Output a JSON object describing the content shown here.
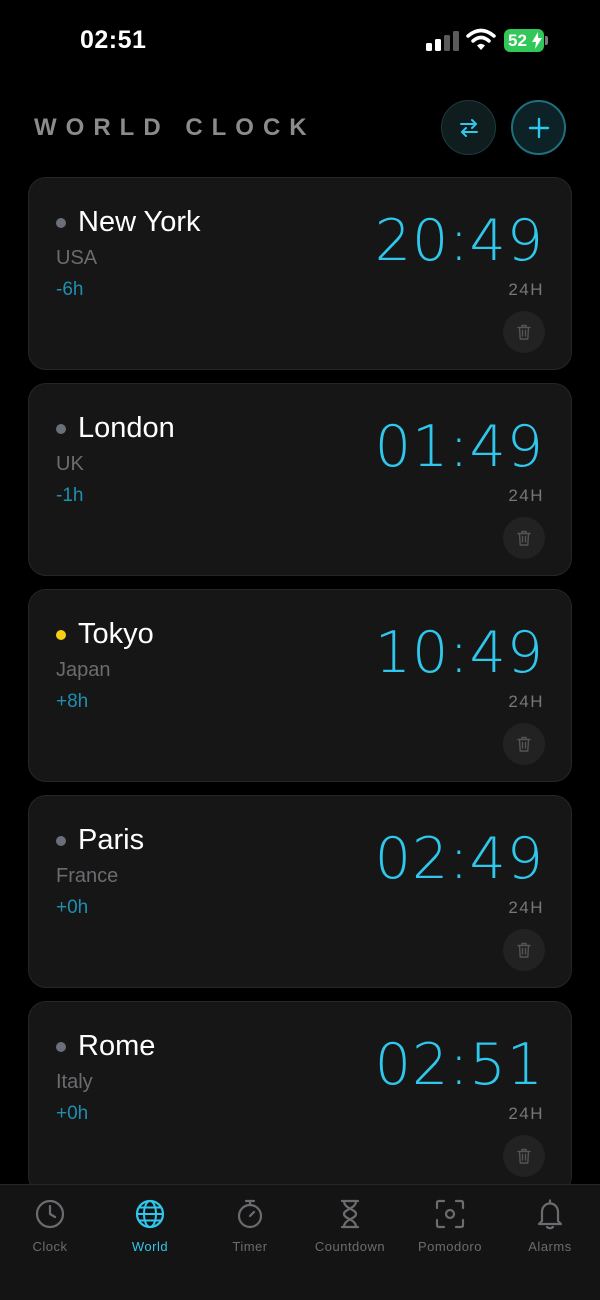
{
  "status": {
    "time": "02:51",
    "battery": "52"
  },
  "header": {
    "title": "WORLD CLOCK",
    "swap_icon": "swap-icon",
    "add_icon": "plus-icon"
  },
  "colors": {
    "accent": "#2fc7ec",
    "offset": "#1e8fb0",
    "dot_default": "#6b6f7a",
    "dot_active": "#f5d014"
  },
  "clocks": [
    {
      "city": "New York",
      "country": "USA",
      "offset": "-6h",
      "time": "20:49",
      "format": "24H",
      "active": false
    },
    {
      "city": "London",
      "country": "UK",
      "offset": "-1h",
      "time": "01:49",
      "format": "24H",
      "active": false
    },
    {
      "city": "Tokyo",
      "country": "Japan",
      "offset": "+8h",
      "time": "10:49",
      "format": "24H",
      "active": true
    },
    {
      "city": "Paris",
      "country": "France",
      "offset": "+0h",
      "time": "02:49",
      "format": "24H",
      "active": false
    },
    {
      "city": "Rome",
      "country": "Italy",
      "offset": "+0h",
      "time": "02:51",
      "format": "24H",
      "active": false
    }
  ],
  "tabs": [
    {
      "label": "Clock",
      "icon": "clock-icon",
      "active": false
    },
    {
      "label": "World",
      "icon": "globe-icon",
      "active": true
    },
    {
      "label": "Timer",
      "icon": "stopwatch-icon",
      "active": false
    },
    {
      "label": "Countdown",
      "icon": "hourglass-icon",
      "active": false
    },
    {
      "label": "Pomodoro",
      "icon": "focus-icon",
      "active": false
    },
    {
      "label": "Alarms",
      "icon": "bell-icon",
      "active": false
    }
  ]
}
